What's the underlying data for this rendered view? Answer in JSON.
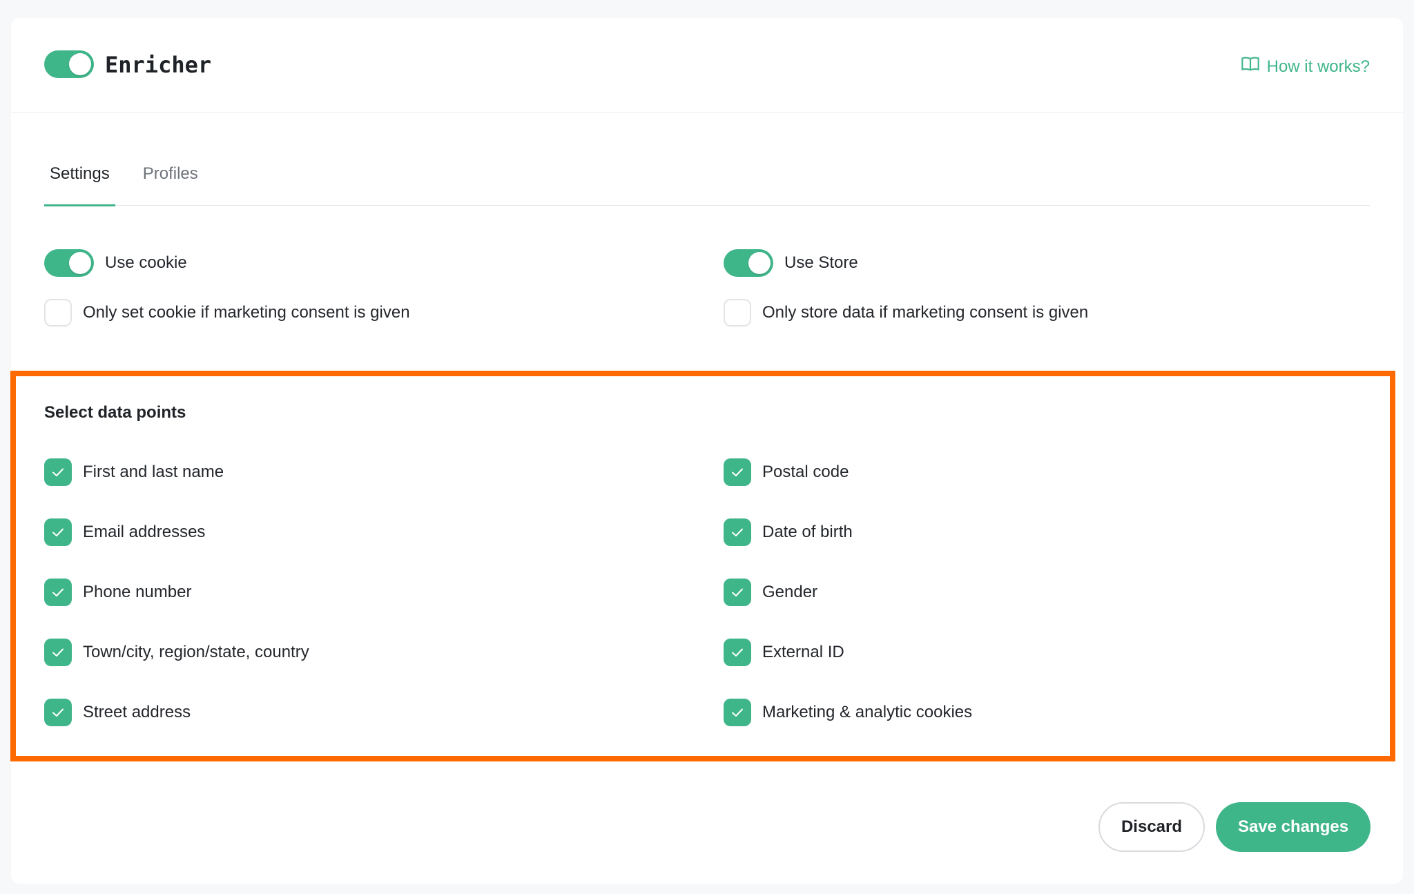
{
  "header": {
    "app_title": "Enricher",
    "enabled": true,
    "help_link": "How it works?"
  },
  "tabs": [
    {
      "label": "Settings",
      "active": true
    },
    {
      "label": "Profiles",
      "active": false
    }
  ],
  "options": {
    "use_cookie": {
      "label": "Use cookie",
      "enabled": true
    },
    "cookie_consent": {
      "label": "Only set cookie if marketing consent is given",
      "checked": false
    },
    "use_store": {
      "label": "Use Store",
      "enabled": true
    },
    "store_consent": {
      "label": "Only store data if marketing consent is given",
      "checked": false
    }
  },
  "data_points": {
    "title": "Select data points",
    "left": [
      {
        "label": "First and last name",
        "checked": true
      },
      {
        "label": "Email addresses",
        "checked": true
      },
      {
        "label": "Phone number",
        "checked": true
      },
      {
        "label": "Town/city, region/state, country",
        "checked": true
      },
      {
        "label": "Street address",
        "checked": true
      }
    ],
    "right": [
      {
        "label": "Postal code",
        "checked": true
      },
      {
        "label": "Date of birth",
        "checked": true
      },
      {
        "label": "Gender",
        "checked": true
      },
      {
        "label": "External ID",
        "checked": true
      },
      {
        "label": "Marketing & analytic cookies",
        "checked": true
      }
    ]
  },
  "actions": {
    "discard": "Discard",
    "save": "Save changes"
  },
  "colors": {
    "accent": "#3fb58a",
    "highlight": "#ff6a00"
  }
}
